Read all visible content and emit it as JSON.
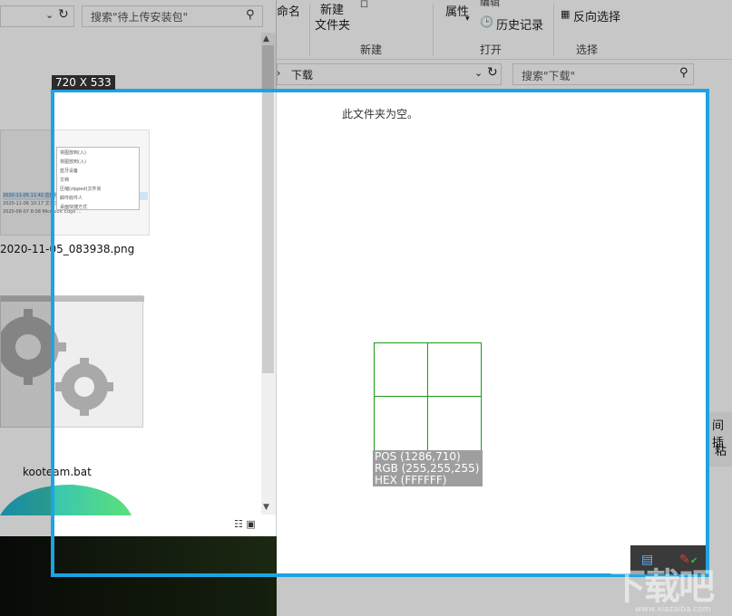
{
  "capture": {
    "size_label": "720 X 533",
    "border_color": "#1ea3e2"
  },
  "left_window": {
    "search_placeholder": "搜索\"待上传安装包\"",
    "files": [
      {
        "name": "2020-11-05_083938.png"
      },
      {
        "name": "kooteam.bat"
      }
    ],
    "thumb_menu_lines": [
      "将图放到(入)",
      "将图放到(入)",
      "蓝牙设备",
      "文档",
      "压缩(zipped)文件夹",
      "邮件收件人",
      "桌面快捷方式"
    ],
    "thumb_rows": [
      "2020-11-05 11:42   应用程序",
      "2020-11-06 10:17   文本文档",
      "2020-08-07 8:08   Microsoft Edge ..."
    ]
  },
  "right_window": {
    "ribbon": {
      "rename_label": "命名",
      "new_folder_label_1": "新建",
      "new_folder_label_2": "文件夹",
      "group_new": "新建",
      "properties_label": "属性",
      "edit_label": "编辑",
      "history_label": "历史记录",
      "group_open": "打开",
      "invert_select_label": "反向选择",
      "group_select": "选择"
    },
    "address": "下载",
    "search_placeholder": "搜索\"下载\"",
    "empty_message": "此文件夹为空。"
  },
  "magnifier": {
    "pos": "POS (1286,710)",
    "rgb": "RGB (255,255,255)",
    "hex": "HEX (FFFFFF)",
    "grid_color": "#1a9a1a"
  },
  "side_buttons": {
    "b1": "间插",
    "b2": "粘"
  },
  "watermark": {
    "main": "下载吧",
    "sub": "www.xiazaiba.com"
  }
}
